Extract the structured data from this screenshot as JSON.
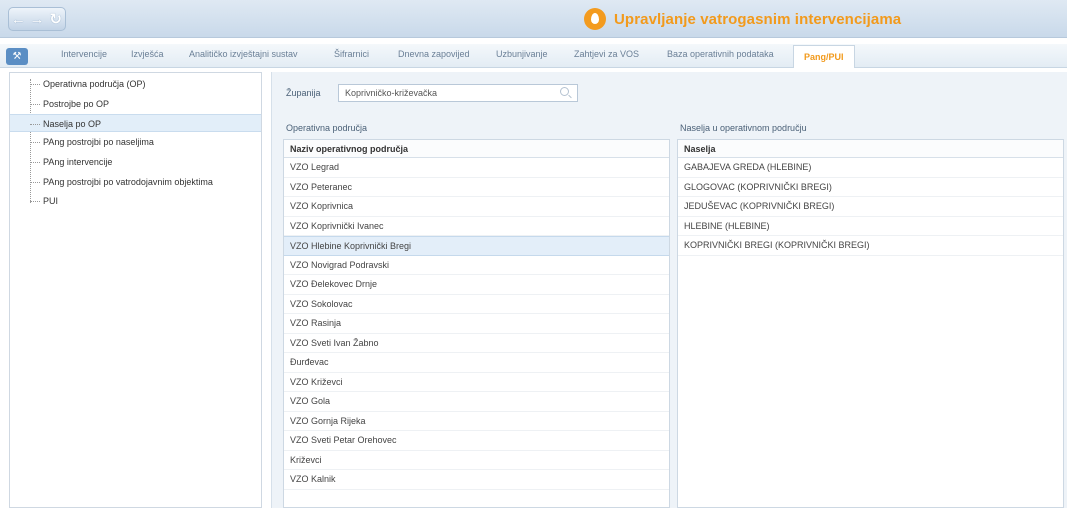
{
  "header": {
    "title": "Upravljanje vatrogasnim intervencijama",
    "nav_icons": [
      "back-arrow-icon",
      "forward-arrow-icon",
      "refresh-icon"
    ],
    "brand_color": "#f29a1c"
  },
  "tabs": {
    "tools_icon": "wrench-icon",
    "items": [
      {
        "label": "Intervencije"
      },
      {
        "label": "Izvješća"
      },
      {
        "label": "Analitičko izvještajni sustav"
      },
      {
        "label": "Šifrarnici"
      },
      {
        "label": "Dnevna zapovijed"
      },
      {
        "label": "Uzbunjivanje"
      },
      {
        "label": "Zahtjevi za VOS"
      },
      {
        "label": "Baza operativnih podataka"
      },
      {
        "label": "Pang/PUI"
      }
    ],
    "active": "Pang/PUI"
  },
  "sidebar": {
    "items": [
      {
        "label": "Operativna područja (OP)"
      },
      {
        "label": "Postrojbe po OP"
      },
      {
        "label": "Naselja po OP"
      },
      {
        "label": "PAng postrojbi po naseljima"
      },
      {
        "label": "PAng intervencije"
      },
      {
        "label": "PAng postrojbi po vatrodojavnim objektima"
      },
      {
        "label": "PUI"
      }
    ],
    "selected": "Naselja po OP"
  },
  "filter": {
    "label": "Županija",
    "value": "Koprivničko-križevačka",
    "icon": "search-icon"
  },
  "left_grid": {
    "section_title": "Operativna područja",
    "column": "Naziv operativnog područja",
    "rows": [
      "VZO Legrad",
      "VZO Peteranec",
      "VZO Koprivnica",
      "VZO Koprivnički Ivanec",
      "VZO Hlebine Koprivnički Bregi",
      "VZO Novigrad Podravski",
      "VZO Đelekovec Drnje",
      "VZO Sokolovac",
      "VZO Rasinja",
      "VZO Sveti Ivan Žabno",
      "Đurđevac",
      "VZO Križevci",
      "VZO Gola",
      "VZO Gornja Rijeka",
      "VZO Sveti Petar Orehovec",
      "Križevci",
      "VZO Kalnik"
    ],
    "selected": "VZO Hlebine Koprivnički Bregi"
  },
  "right_grid": {
    "section_title": "Naselja u operativnom području",
    "column": "Naselja",
    "rows": [
      "GABAJEVA GREDA (HLEBINE)",
      "GLOGOVAC (KOPRIVNIČKI BREGI)",
      "JEDUŠEVAC (KOPRIVNIČKI BREGI)",
      "HLEBINE (HLEBINE)",
      "KOPRIVNIČKI BREGI (KOPRIVNIČKI BREGI)"
    ]
  }
}
